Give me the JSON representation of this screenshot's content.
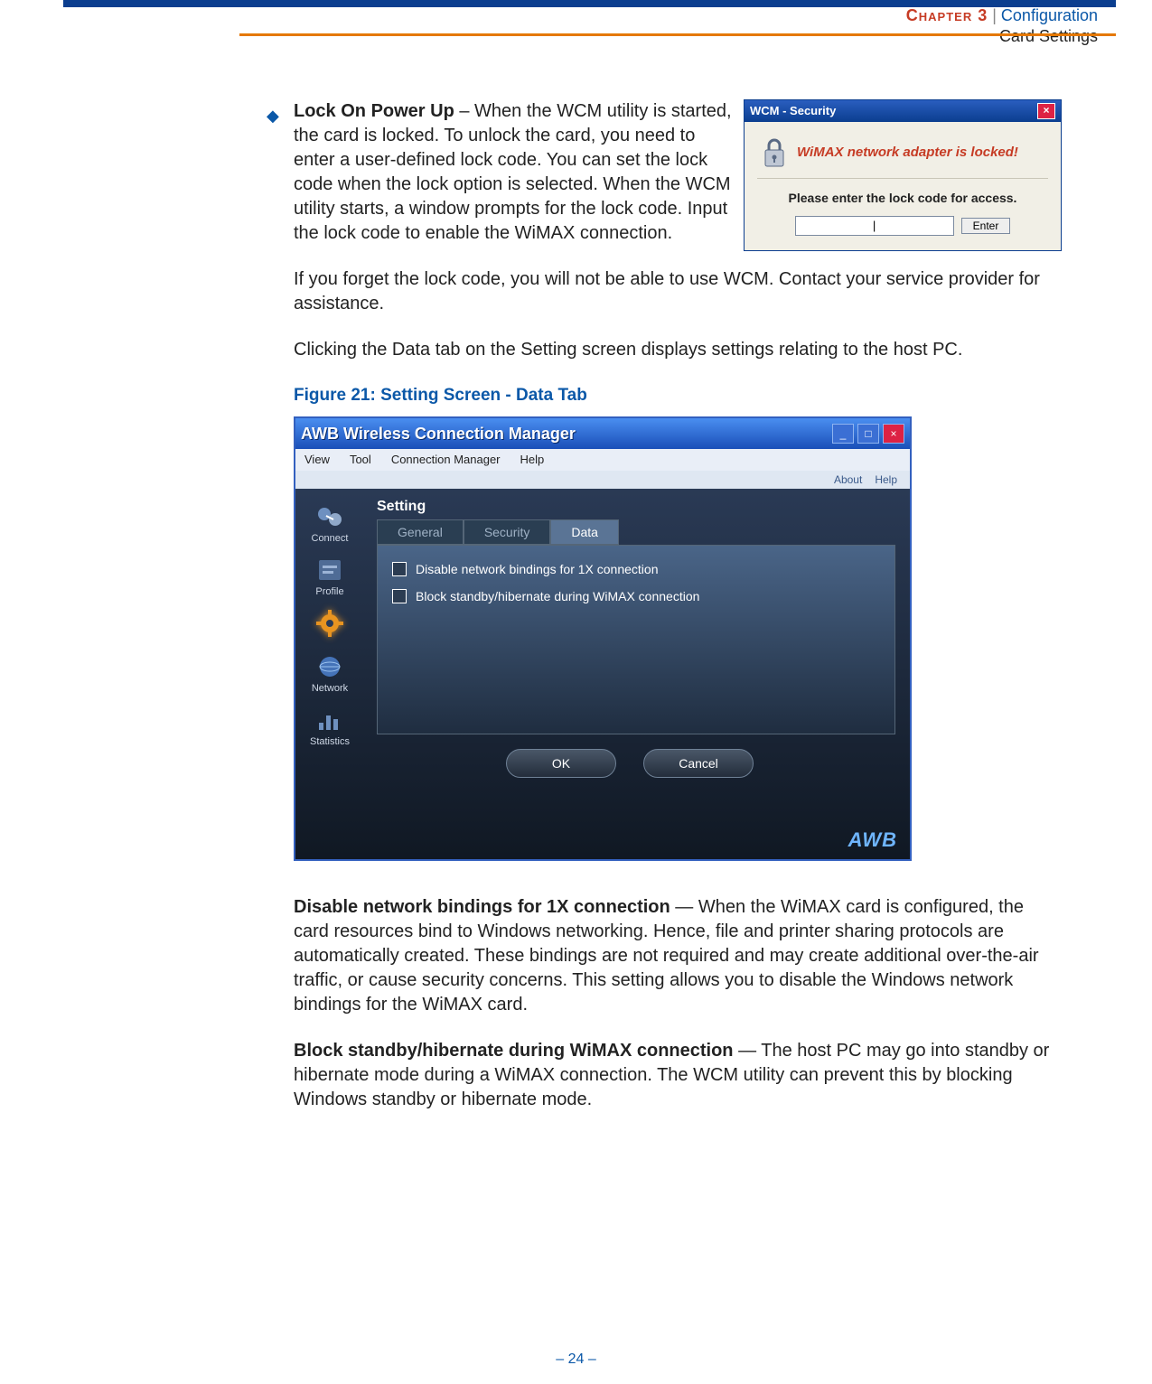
{
  "header": {
    "chapter": "Chapter 3",
    "pipe": "  |  ",
    "section": "Configuration",
    "sub": "Card Settings"
  },
  "bullet": {
    "title": "Lock On Power Up",
    "desc": " – When the WCM utility is started, the card is locked. To unlock the card, you need to enter a user-defined lock code. You can set the lock code when the lock option is selected. When the WCM utility starts, a window prompts for the lock code. Input the lock code to enable the WiMAX connection."
  },
  "security_popup": {
    "title": "WCM - Security",
    "message": "WiMAX network adapter is locked!",
    "prompt": "Please enter the lock code for access.",
    "enter_btn": "Enter"
  },
  "para_forget": "If you forget the lock code, you will not be able to use WCM. Contact your service provider for assistance.",
  "para_datatab": "Clicking the Data tab on the Setting screen displays settings relating to the host PC.",
  "figure_caption": "Figure 21:  Setting Screen - Data Tab",
  "app": {
    "title": "AWB Wireless Connection Manager",
    "menu": [
      "View",
      "Tool",
      "Connection Manager",
      "Help"
    ],
    "toplinks": [
      "About",
      "Help"
    ],
    "sidebar": [
      {
        "label": "Connect"
      },
      {
        "label": "Profile"
      },
      {
        "label": ""
      },
      {
        "label": "Network"
      },
      {
        "label": "Statistics"
      }
    ],
    "setting_title": "Setting",
    "tabs": {
      "general": "General",
      "security": "Security",
      "data": "Data"
    },
    "checkbox1": "Disable network bindings for 1X connection",
    "checkbox2": "Block standby/hibernate during WiMAX connection",
    "ok": "OK",
    "cancel": "Cancel",
    "logo": "AWB"
  },
  "disable_title": "Disable network bindings for 1X connection",
  "disable_desc": " — When the WiMAX card is configured, the card resources bind to Windows networking. Hence, file and printer sharing protocols are automatically created. These bindings are not required and may create additional over-the-air traffic, or cause security concerns. This setting allows you to disable the Windows network bindings for the WiMAX card.",
  "block_title": "Block standby/hibernate during WiMAX connection",
  "block_desc": " — The host PC may go into standby or hibernate mode during a WiMAX connection. The WCM utility can prevent this by blocking Windows standby or hibernate mode.",
  "page_num": "–  24  –"
}
